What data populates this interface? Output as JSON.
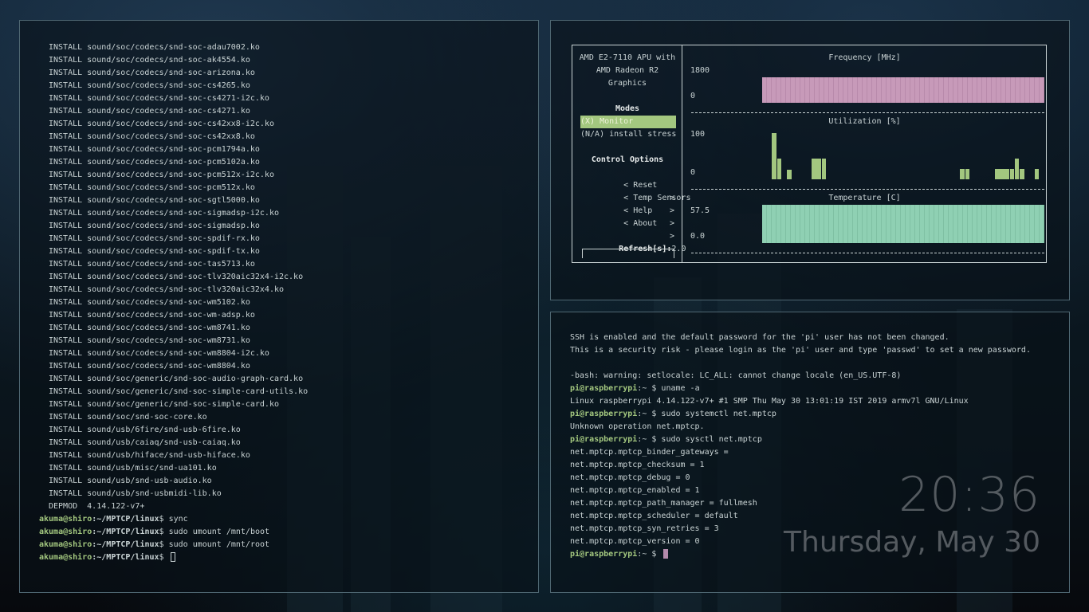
{
  "left_terminal": {
    "install_lines": [
      "INSTALL sound/soc/codecs/snd-soc-adau7002.ko",
      "INSTALL sound/soc/codecs/snd-soc-ak4554.ko",
      "INSTALL sound/soc/codecs/snd-soc-arizona.ko",
      "INSTALL sound/soc/codecs/snd-soc-cs4265.ko",
      "INSTALL sound/soc/codecs/snd-soc-cs4271-i2c.ko",
      "INSTALL sound/soc/codecs/snd-soc-cs4271.ko",
      "INSTALL sound/soc/codecs/snd-soc-cs42xx8-i2c.ko",
      "INSTALL sound/soc/codecs/snd-soc-cs42xx8.ko",
      "INSTALL sound/soc/codecs/snd-soc-pcm1794a.ko",
      "INSTALL sound/soc/codecs/snd-soc-pcm5102a.ko",
      "INSTALL sound/soc/codecs/snd-soc-pcm512x-i2c.ko",
      "INSTALL sound/soc/codecs/snd-soc-pcm512x.ko",
      "INSTALL sound/soc/codecs/snd-soc-sgtl5000.ko",
      "INSTALL sound/soc/codecs/snd-soc-sigmadsp-i2c.ko",
      "INSTALL sound/soc/codecs/snd-soc-sigmadsp.ko",
      "INSTALL sound/soc/codecs/snd-soc-spdif-rx.ko",
      "INSTALL sound/soc/codecs/snd-soc-spdif-tx.ko",
      "INSTALL sound/soc/codecs/snd-soc-tas5713.ko",
      "INSTALL sound/soc/codecs/snd-soc-tlv320aic32x4-i2c.ko",
      "INSTALL sound/soc/codecs/snd-soc-tlv320aic32x4.ko",
      "INSTALL sound/soc/codecs/snd-soc-wm5102.ko",
      "INSTALL sound/soc/codecs/snd-soc-wm-adsp.ko",
      "INSTALL sound/soc/codecs/snd-soc-wm8741.ko",
      "INSTALL sound/soc/codecs/snd-soc-wm8731.ko",
      "INSTALL sound/soc/codecs/snd-soc-wm8804-i2c.ko",
      "INSTALL sound/soc/codecs/snd-soc-wm8804.ko",
      "INSTALL sound/soc/generic/snd-soc-audio-graph-card.ko",
      "INSTALL sound/soc/generic/snd-soc-simple-card-utils.ko",
      "INSTALL sound/soc/generic/snd-soc-simple-card.ko",
      "INSTALL sound/soc/snd-soc-core.ko",
      "INSTALL sound/usb/6fire/snd-usb-6fire.ko",
      "INSTALL sound/usb/caiaq/snd-usb-caiaq.ko",
      "INSTALL sound/usb/hiface/snd-usb-hiface.ko",
      "INSTALL sound/usb/misc/snd-ua101.ko",
      "INSTALL sound/usb/snd-usb-audio.ko",
      "INSTALL sound/usb/snd-usbmidi-lib.ko",
      "DEPMOD  4.14.122-v7+"
    ],
    "prompt_user": "akuma@shiro",
    "prompt_path": ":~/MPTCP/linux",
    "prompt_symbol": "$",
    "commands": [
      "sync",
      "sudo umount /mnt/boot",
      "sudo umount /mnt/root",
      ""
    ]
  },
  "stress_monitor": {
    "cpu_name_lines": [
      "AMD E2-7110 APU with",
      "AMD Radeon R2",
      "Graphics"
    ],
    "modes_header": "Modes",
    "modes": [
      "(X) Monitor",
      "(N/A) install stress"
    ],
    "control_header": "Control Options",
    "controls": [
      {
        "left": "< Reset",
        "right": ">"
      },
      {
        "left": "< Temp Sensors",
        "right": ">"
      },
      {
        "left": "< Help",
        "right": ">"
      },
      {
        "left": "< About",
        "right": ">"
      }
    ],
    "refresh_label": "Refresh[s]:",
    "refresh_value": "2.0",
    "graphs": {
      "frequency": {
        "title": "Frequency [MHz]",
        "max_label": "1800",
        "min_label": "0",
        "fill_fraction": 1.0,
        "color": "#c79ab9"
      },
      "utilization": {
        "title": "Utilization [%]",
        "max_label": "100",
        "min_label": "0",
        "color": "#a3c77f",
        "samples": [
          0,
          0,
          90,
          40,
          0,
          18,
          0,
          0,
          0,
          0,
          40,
          40,
          40,
          0,
          0,
          0,
          0,
          0,
          0,
          0,
          0,
          0,
          0,
          0,
          0,
          0,
          0,
          0,
          0,
          0,
          0,
          0,
          0,
          0,
          0,
          0,
          0,
          0,
          0,
          0,
          20,
          20,
          0,
          0,
          0,
          0,
          0,
          20,
          20,
          20,
          20,
          40,
          20,
          0,
          0,
          20,
          0
        ]
      },
      "temperature": {
        "title": "Temperature [C]",
        "max_label": "57.5",
        "min_label": "0.0",
        "fill_fraction": 1.0,
        "color": "#8fd0b3"
      }
    }
  },
  "ssh_terminal": {
    "lines": [
      {
        "text": "SSH is enabled and the default password for the 'pi' user has not been changed."
      },
      {
        "text": "This is a security risk - please login as the 'pi' user and type 'passwd' to set a new password."
      },
      {
        "text": ""
      },
      {
        "text": "-bash: warning: setlocale: LC_ALL: cannot change locale (en_US.UTF-8)"
      },
      {
        "prompt": "pi@raspberrypi",
        "cmd": "uname -a"
      },
      {
        "text": "Linux raspberrypi 4.14.122-v7+ #1 SMP Thu May 30 13:01:19 IST 2019 armv7l GNU/Linux"
      },
      {
        "prompt": "pi@raspberrypi",
        "cmd": "sudo systemctl net.mptcp"
      },
      {
        "text": "Unknown operation net.mptcp."
      },
      {
        "prompt": "pi@raspberrypi",
        "cmd": "sudo sysctl net.mptcp"
      },
      {
        "text": "net.mptcp.mptcp_binder_gateways ="
      },
      {
        "text": "net.mptcp.mptcp_checksum = 1"
      },
      {
        "text": "net.mptcp.mptcp_debug = 0"
      },
      {
        "text": "net.mptcp.mptcp_enabled = 1"
      },
      {
        "text": "net.mptcp.mptcp_path_manager = fullmesh"
      },
      {
        "text": "net.mptcp.mptcp_scheduler = default"
      },
      {
        "text": "net.mptcp.mptcp_syn_retries = 3"
      },
      {
        "text": "net.mptcp.mptcp_version = 0"
      },
      {
        "prompt": "pi@raspberrypi",
        "cmd": "",
        "cursor": true
      }
    ],
    "prompt_suffix": ":~ $"
  },
  "desktop_clock": {
    "time": "20:36",
    "date": "Thursday, May 30"
  }
}
